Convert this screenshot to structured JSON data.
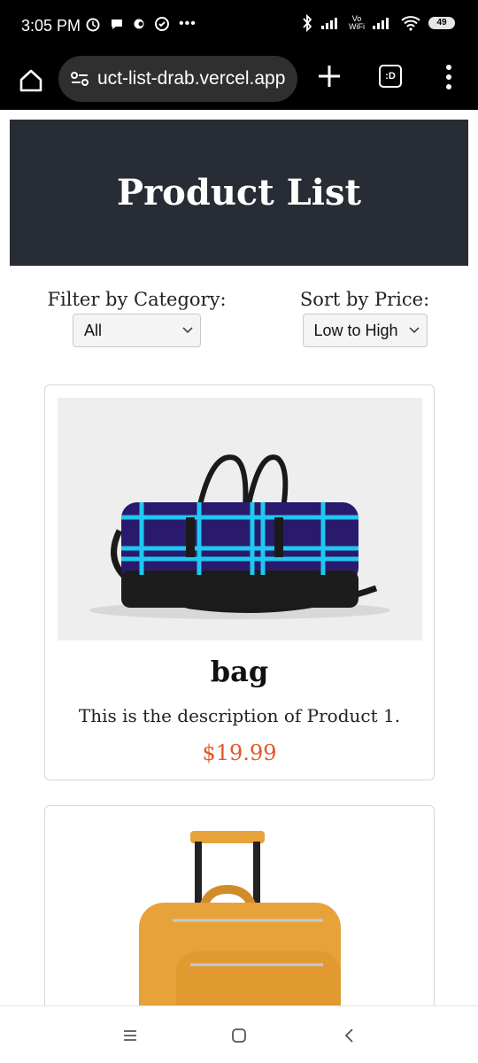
{
  "status_bar": {
    "time": "3:05 PM",
    "vo_wifi_top": "Vo",
    "vo_wifi_bottom": "WiFi",
    "battery": "49"
  },
  "browser": {
    "url": "uct-list-drab.vercel.app",
    "tab_icon_text": ":D"
  },
  "page": {
    "title": "Product List",
    "filter": {
      "label": "Filter by Category:",
      "selected": "All"
    },
    "sort": {
      "label": "Sort by Price:",
      "selected": "Low to High"
    }
  },
  "products": [
    {
      "name": "bag",
      "description": "This is the description of Product 1.",
      "price": "$19.99"
    }
  ],
  "colors": {
    "header_bg": "#282c34",
    "price": "#e2572a",
    "bag_blue": "#2a1a6e",
    "bag_cyan": "#1ec8f0",
    "suitcase_orange": "#e8a23a"
  }
}
